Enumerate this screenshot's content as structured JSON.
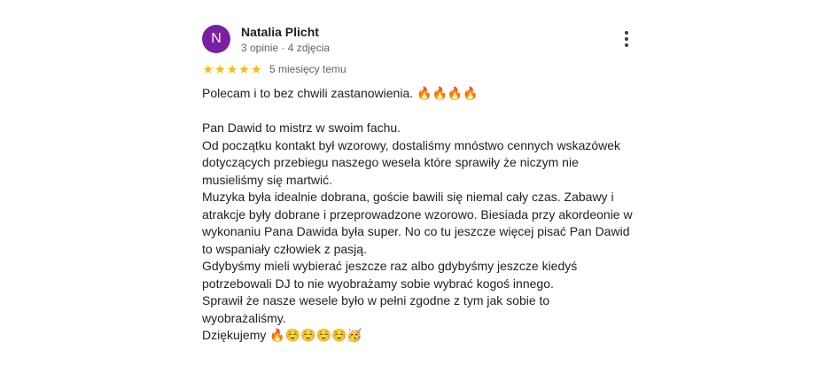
{
  "review": {
    "author": {
      "initial": "N",
      "name": "Natalia Plicht",
      "meta": "3 opinie · 4 zdjęcia",
      "avatar_color": "#7b1fa2"
    },
    "rating": 5,
    "rating_max": 5,
    "star_color": "#fbbc04",
    "age": "5 miesięcy temu",
    "more_icon": "more-vert-icon",
    "text": "Polecam i to bez chwili zastanowienia. 🔥🔥🔥🔥\n\nPan Dawid to mistrz w swoim fachu.\nOd początku kontakt był wzorowy, dostaliśmy mnóstwo cennych wskazówek\ndotyczących przebiegu naszego wesela które sprawiły że niczym nie\nmusieliśmy się martwić.\nMuzyka była idealnie dobrana, goście bawili się niemal cały czas. Zabawy i\natrakcje były dobrane i przeprowadzone wzorowo. Biesiada przy akordeonie w\nwykonaniu Pana Dawida była super. No co tu jeszcze więcej pisać Pan Dawid\nto wspaniały człowiek z pasją.\nGdybyśmy mieli wybierać jeszcze raz albo gdybyśmy jeszcze kiedyś\npotrzebowali DJ to nie wyobrażamy sobie wybrać kogoś innego.\nSprawił że nasze wesele było w pełni zgodne z tym jak sobie to\nwyobrażaliśmy.\nDziękujemy 🔥☺️☺️☺️☺️🥳"
  }
}
